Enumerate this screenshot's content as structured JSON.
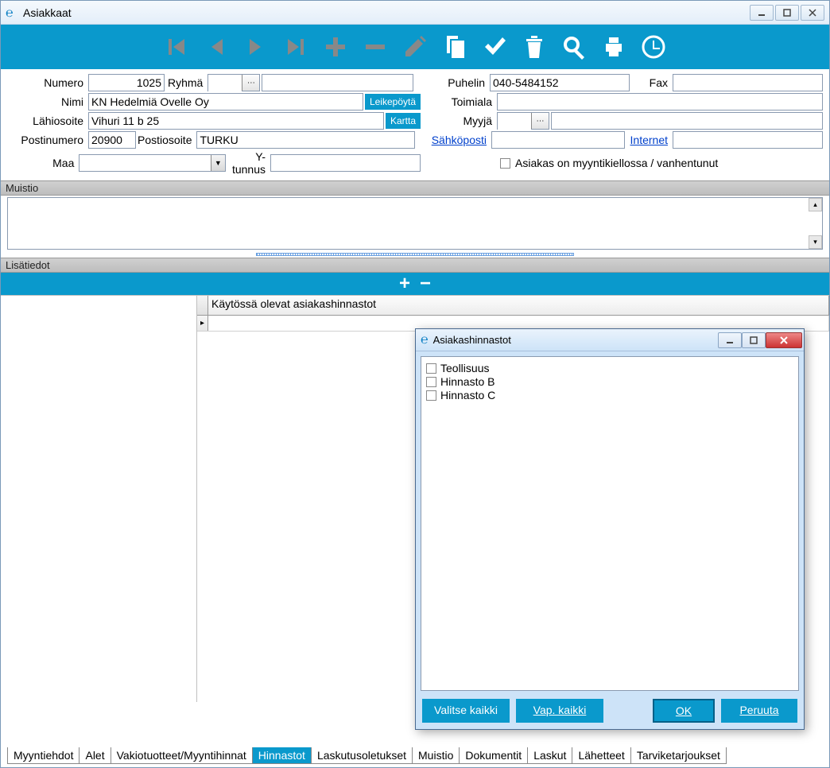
{
  "window": {
    "title": "Asiakkaat",
    "app_glyph": "℮"
  },
  "form": {
    "numero_label": "Numero",
    "numero_value": "1025",
    "ryhma_label": "Ryhmä",
    "ryhma_value": "",
    "ryhma_desc": "",
    "nimi_label": "Nimi",
    "nimi_value": "KN Hedelmiä Ovelle Oy",
    "leikepoyta_btn": "Leikepöytä",
    "lahiosoite_label": "Lähiosoite",
    "lahiosoite_value": "Vihuri 11 b 25",
    "kartta_btn": "Kartta",
    "postinumero_label": "Postinumero",
    "postinumero_value": "20900",
    "postiosoite_label": "Postiosoite",
    "postiosoite_value": "TURKU",
    "maa_label": "Maa",
    "maa_value": "",
    "ytunnus_label": "Y-tunnus",
    "ytunnus_value": "",
    "puhelin_label": "Puhelin",
    "puhelin_value": "040-5484152",
    "fax_label": "Fax",
    "fax_value": "",
    "toimiala_label": "Toimiala",
    "toimiala_value": "",
    "myyja_label": "Myyjä",
    "myyja_value": "",
    "myyja_desc": "",
    "sahkoposti_label": "Sähköposti",
    "sahkoposti_value": "",
    "internet_label": "Internet",
    "internet_value": "",
    "myyntikielto_label": "Asiakas on myyntikiellossa / vanhentunut",
    "muistio_header": "Muistio",
    "lisatiedot_header": "Lisätiedot"
  },
  "grid": {
    "col1": "Käytössä olevat asiakashinnastot"
  },
  "tabs": [
    "Myyntiehdot",
    "Alet",
    "Vakiotuotteet/Myyntihinnat",
    "Hinnastot",
    "Laskutusoletukset",
    "Muistio",
    "Dokumentit",
    "Laskut",
    "Lähetteet",
    "Tarviketarjoukset"
  ],
  "tabs_active_index": 3,
  "modal": {
    "title": "Asiakashinnastot",
    "options": [
      "Teollisuus",
      "Hinnasto B",
      "Hinnasto C"
    ],
    "btn_select_all": "Valitse kaikki",
    "btn_deselect_all": "Vap. kaikki",
    "btn_ok": "OK",
    "btn_cancel": "Peruuta"
  }
}
